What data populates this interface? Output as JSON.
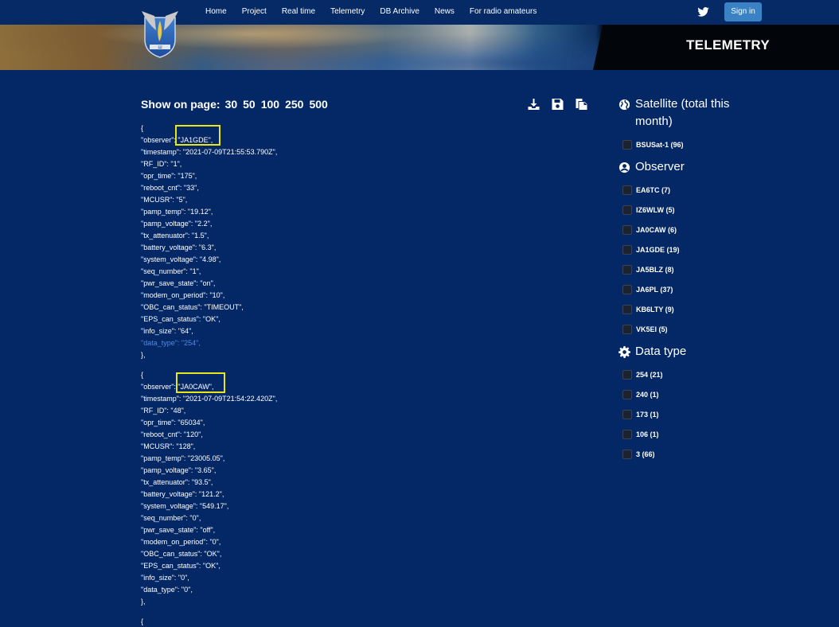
{
  "nav": {
    "links": [
      "Home",
      "Project",
      "Real time",
      "Telemetry",
      "DB Archive",
      "News",
      "For radio amateurs"
    ],
    "signin_label": "Sign in"
  },
  "banner": {
    "title": "TELEMETRY"
  },
  "pager": {
    "label": "Show on page:",
    "options": [
      "30",
      "50",
      "100",
      "250",
      "500"
    ]
  },
  "toolbar": {
    "icons": [
      "download-icon",
      "save-icon",
      "copy-icon"
    ]
  },
  "records": [
    {
      "lines": [
        "{",
        "\"observer\": \"JA1GDE\",",
        "\"timestamp\": \"2021-07-09T21:55:53.790Z\",",
        "\"RF_ID\": \"1\",",
        "\"opr_time\": \"175\",",
        "\"reboot_cnt\": \"33\",",
        "\"MCUSR\": \"5\",",
        "\"pamp_temp\": \"19.12\",",
        "\"pamp_voltage\": \"2.2\",",
        "\"tx_attenuator\": \"1.5\",",
        "\"battery_voltage\": \"6.3\",",
        "\"system_voltage\": \"4.98\",",
        "\"seq_number\": \"1\",",
        "\"pwr_save_state\": \"on\",",
        "\"modem_on_period\": \"10\",",
        "\"OBC_can_status\": \"TIMEOUT\",",
        "\"EPS_can_status\": \"OK\",",
        "\"info_size\": \"64\",",
        "\"data_type\": \"254\",",
        "},"
      ]
    },
    {
      "lines": [
        "{",
        "\"observer\": \"JA0CAW\",",
        "\"timestamp\": \"2021-07-09T21:54:22.420Z\",",
        "\"RF_ID\": \"48\",",
        "\"opr_time\": \"65034\",",
        "\"reboot_cnt\": \"120\",",
        "\"MCUSR\": \"128\",",
        "\"pamp_temp\": \"23005.05\",",
        "\"pamp_voltage\": \"3.65\",",
        "\"tx_attenuator\": \"93.5\",",
        "\"battery_voltage\": \"121.2\",",
        "\"system_voltage\": \"549.17\",",
        "\"seq_number\": \"0\",",
        "\"pwr_save_state\": \"off\",",
        "\"modem_on_period\": \"0\",",
        "\"OBC_can_status\": \"OK\",",
        "\"EPS_can_status\": \"OK\",",
        "\"info_size\": \"0\",",
        "\"data_type\": \"0\",",
        "},"
      ]
    },
    {
      "lines": [
        "{"
      ]
    }
  ],
  "sidebar": {
    "satellite_heading": "Satellite (total this month)",
    "satellites": [
      "BSUSat-1 (96)"
    ],
    "observer_heading": "Observer",
    "observers": [
      "EA6TC (7)",
      "IZ6WLW (5)",
      "JA0CAW (6)",
      "JA1GDE (19)",
      "JA5BLZ (8)",
      "JA6PL (37)",
      "KB6LTY (9)",
      "VK5EI (5)"
    ],
    "datatype_heading": "Data type",
    "datatypes": [
      "254 (21)",
      "240 (1)",
      "173 (1)",
      "106 (1)",
      "3 (66)"
    ]
  },
  "colors": {
    "background": "#042865",
    "highlight": "#e8e51b",
    "signin": "#3b82c4",
    "dim_line": "#4f8be0"
  }
}
